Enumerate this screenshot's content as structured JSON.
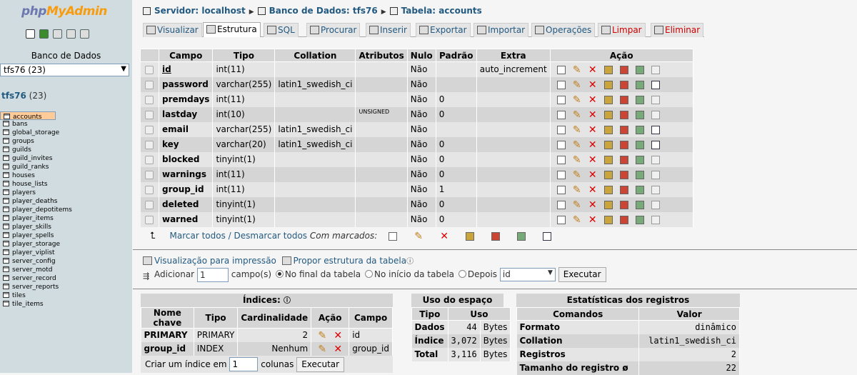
{
  "app": {
    "logo_a": "php",
    "logo_b": "MyAdmin"
  },
  "sidebar": {
    "db_label": "Banco de Dados",
    "db_select": "tfs76 (23)",
    "db_name": "tfs76",
    "db_count": "(23)",
    "tables": [
      "accounts",
      "bans",
      "global_storage",
      "groups",
      "guilds",
      "guild_invites",
      "guild_ranks",
      "houses",
      "house_lists",
      "players",
      "player_deaths",
      "player_depotitems",
      "player_items",
      "player_skills",
      "player_spells",
      "player_storage",
      "player_viplist",
      "server_config",
      "server_motd",
      "server_record",
      "server_reports",
      "tiles",
      "tile_items"
    ],
    "selected": "accounts"
  },
  "breadcrumb": {
    "server": "Servidor: localhost",
    "database": "Banco de Dados: tfs76",
    "table": "Tabela: accounts"
  },
  "tabs": [
    "Visualizar",
    "Estrutura",
    "SQL",
    "Procurar",
    "Inserir",
    "Exportar",
    "Importar",
    "Operações",
    "Limpar",
    "Eliminar"
  ],
  "structure": {
    "headers": [
      "Campo",
      "Tipo",
      "Collation",
      "Atributos",
      "Nulo",
      "Padrão",
      "Extra",
      "Ação"
    ],
    "rows": [
      {
        "field": "id",
        "type": "int(11)",
        "collation": "",
        "attributes": "",
        "null": "Não",
        "default": "",
        "extra": "auto_increment"
      },
      {
        "field": "password",
        "type": "varchar(255)",
        "collation": "latin1_swedish_ci",
        "attributes": "",
        "null": "Não",
        "default": "",
        "extra": ""
      },
      {
        "field": "premdays",
        "type": "int(11)",
        "collation": "",
        "attributes": "",
        "null": "Não",
        "default": "0",
        "extra": ""
      },
      {
        "field": "lastday",
        "type": "int(10)",
        "collation": "",
        "attributes": "UNSIGNED",
        "null": "Não",
        "default": "0",
        "extra": ""
      },
      {
        "field": "email",
        "type": "varchar(255)",
        "collation": "latin1_swedish_ci",
        "attributes": "",
        "null": "Não",
        "default": "",
        "extra": ""
      },
      {
        "field": "key",
        "type": "varchar(20)",
        "collation": "latin1_swedish_ci",
        "attributes": "",
        "null": "Não",
        "default": "0",
        "extra": ""
      },
      {
        "field": "blocked",
        "type": "tinyint(1)",
        "collation": "",
        "attributes": "",
        "null": "Não",
        "default": "0",
        "extra": ""
      },
      {
        "field": "warnings",
        "type": "int(11)",
        "collation": "",
        "attributes": "",
        "null": "Não",
        "default": "0",
        "extra": ""
      },
      {
        "field": "group_id",
        "type": "int(11)",
        "collation": "",
        "attributes": "",
        "null": "Não",
        "default": "1",
        "extra": ""
      },
      {
        "field": "deleted",
        "type": "tinyint(1)",
        "collation": "",
        "attributes": "",
        "null": "Não",
        "default": "0",
        "extra": ""
      },
      {
        "field": "warned",
        "type": "tinyint(1)",
        "collation": "",
        "attributes": "",
        "null": "Não",
        "default": "0",
        "extra": ""
      }
    ],
    "mark_all": "Marcar todos",
    "unmark_all": "Desmarcar todos",
    "with_selected": "Com marcados:"
  },
  "options": {
    "print_view": "Visualização para impressão",
    "propose": "Propor estrutura da tabela",
    "add_label": "Adicionar",
    "add_count": "1",
    "fields_text": "campo(s)",
    "at_end": "No final da tabela",
    "at_start": "No início da tabela",
    "after": "Depois",
    "after_field": "id",
    "execute": "Executar"
  },
  "indexes": {
    "title": "Índices:",
    "headers": [
      "Nome chave",
      "Tipo",
      "Cardinalidade",
      "Ação",
      "Campo"
    ],
    "rows": [
      {
        "name": "PRIMARY",
        "type": "PRIMARY",
        "card": "2",
        "field": "id"
      },
      {
        "name": "group_id",
        "type": "INDEX",
        "card": "Nenhum",
        "field": "group_id"
      }
    ],
    "create_label": "Criar um índice em",
    "create_count": "1",
    "columns_text": "colunas",
    "execute": "Executar"
  },
  "space": {
    "title": "Uso do espaço",
    "headers": [
      "Tipo",
      "Uso"
    ],
    "rows": [
      {
        "type": "Dados",
        "val": "44",
        "unit": "Bytes"
      },
      {
        "type": "Índice",
        "val": "3,072",
        "unit": "Bytes"
      },
      {
        "type": "Total",
        "val": "3,116",
        "unit": "Bytes"
      }
    ]
  },
  "stats": {
    "title": "Estatísticas dos registros",
    "headers": [
      "Comandos",
      "Valor"
    ],
    "rows": [
      {
        "k": "Formato",
        "v": "dinâmico"
      },
      {
        "k": "Collation",
        "v": "latin1_swedish_ci"
      },
      {
        "k": "Registros",
        "v": "2"
      },
      {
        "k": "Tamanho do registro ø",
        "v": "22"
      }
    ]
  }
}
